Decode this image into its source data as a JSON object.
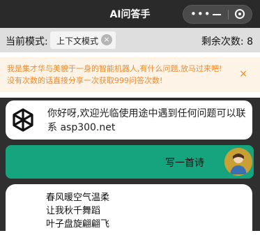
{
  "header": {
    "title": "AI问答手",
    "more_icon": "more-dots-icon",
    "minimize_icon": "minimize-icon",
    "close_icon": "target-close-icon"
  },
  "mode_bar": {
    "label": "当前模式:",
    "chip_text": "上下文模式",
    "chip_close": "×",
    "remaining_label": "剩余次数:",
    "remaining_count": "8"
  },
  "notice": {
    "text": "我是集才华与美貌于一身的智能机器人,有什么问题,放马过来吧!没有次数的话直接分享一次获取999问答次数!",
    "close": "×",
    "color": "#f08a2b"
  },
  "messages": {
    "greeting": "你好呀,欢迎光临使用途中遇到任何问题可以联系 asp300.net",
    "user_prompt": "写一首诗",
    "reply_lines": [
      "春风暖空气温柔",
      "让我秋千舞蹈",
      "叶子盘旋翩翩飞"
    ]
  },
  "colors": {
    "topbar": "#2a2a2a",
    "user_bubble": "#16a47e",
    "chat_bg": "#2f2f2f"
  }
}
